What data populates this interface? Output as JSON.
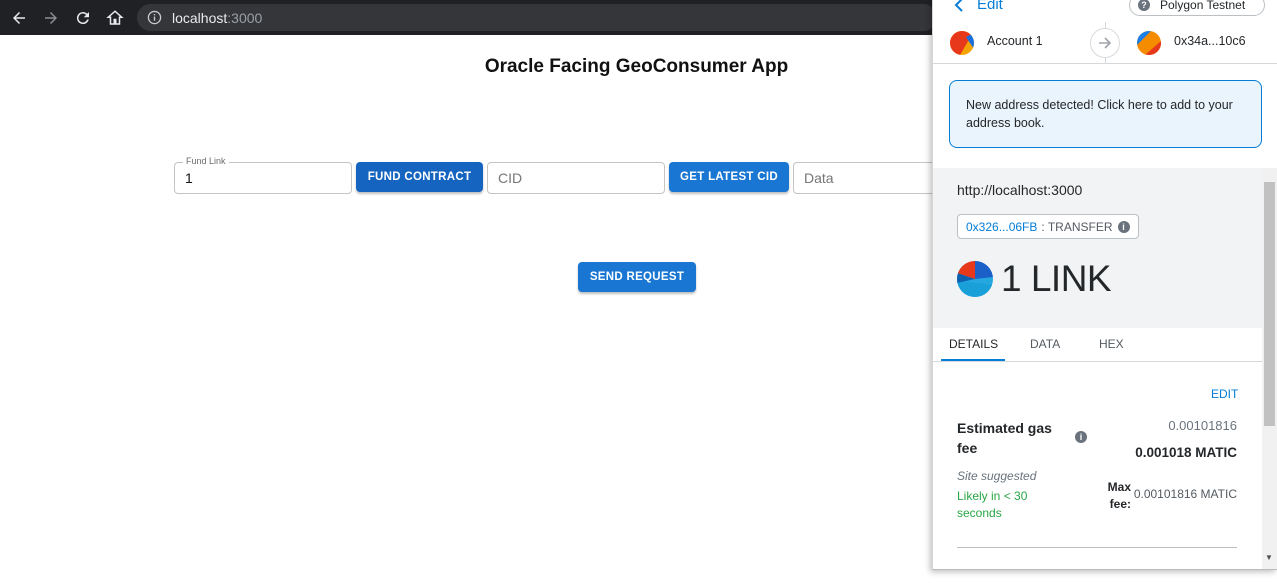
{
  "browser": {
    "url_host": "localhost",
    "url_port": ":3000"
  },
  "app": {
    "title": "Oracle Facing GeoConsumer App",
    "fund_link_label": "Fund Link",
    "fund_link_value": "1",
    "fund_contract_button": "FUND CONTRACT",
    "cid_placeholder": "CID",
    "get_latest_cid_button": "GET LATEST CID",
    "data_placeholder": "Data",
    "send_request_button": "SEND REQUEST"
  },
  "wallet": {
    "back_label": "Edit",
    "network": "Polygon Testnet",
    "network_icon": "?",
    "from_account": "Account 1",
    "to_account": "0x34a...10c6",
    "alert_text": "New address detected! Click here to add to your address book.",
    "origin": "http://localhost:3000",
    "method_address": "0x326...06FB",
    "method_name": ": TRANSFER",
    "amount": "1 LINK",
    "tabs": [
      "DETAILS",
      "DATA",
      "HEX"
    ],
    "active_tab": "DETAILS",
    "edit_link": "EDIT",
    "gas_label": "Estimated gas fee",
    "gas_secondary": "0.00101816",
    "gas_primary": "0.001018 MATIC",
    "site_suggested": "Site suggested",
    "likely_text": "Likely in < 30 seconds",
    "max_fee_label": "Max fee:",
    "max_fee_value": "0.00101816 MATIC",
    "accent_color": "#037dd6",
    "success_color": "#28a745"
  }
}
